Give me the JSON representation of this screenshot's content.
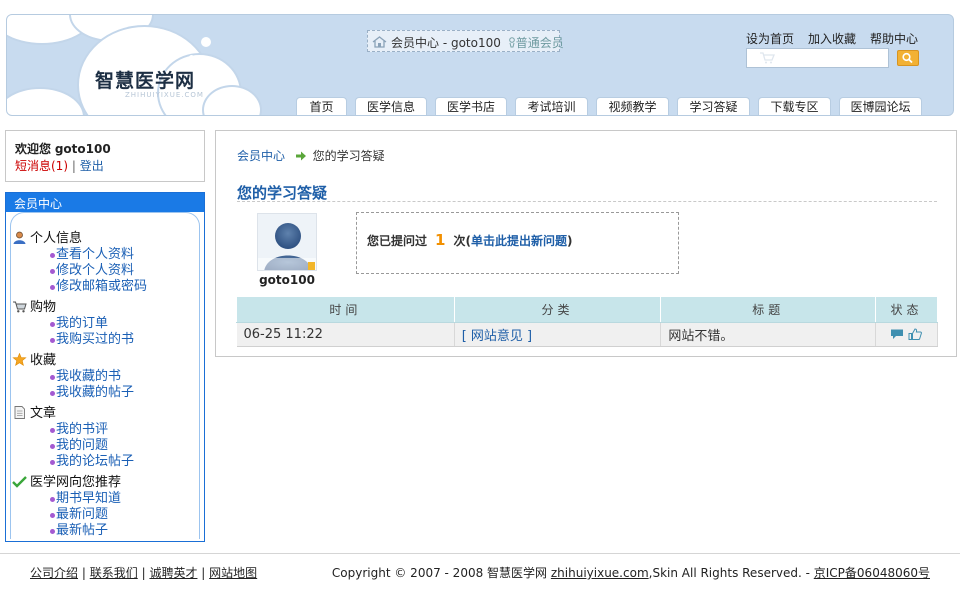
{
  "header": {
    "logo": "智慧医学网",
    "logo_sub": "ZHIHUIYIXUE.COM",
    "user_badge": {
      "text": "会员中心 - goto100",
      "level": "普通会员"
    },
    "top_links": [
      "设为首页",
      "加入收藏",
      "帮助中心"
    ],
    "search": {
      "value": "",
      "placeholder": ""
    },
    "nav_tabs": [
      "首页",
      "医学信息",
      "医学书店",
      "考试培训",
      "视频教学",
      "学习答疑",
      "下载专区",
      "医博园论坛"
    ]
  },
  "sidebar": {
    "welcome_label": "欢迎您",
    "username": "goto100",
    "messages_link": "短消息(1)",
    "separator": "|",
    "logout_link": "登出",
    "member_title": "会员中心",
    "categories": [
      {
        "label": "个人信息",
        "icon": "person-icon",
        "items": [
          "查看个人资料",
          "修改个人资料",
          "修改邮箱或密码"
        ]
      },
      {
        "label": "购物",
        "icon": "cart-icon",
        "items": [
          "我的订单",
          "我购买过的书"
        ]
      },
      {
        "label": "收藏",
        "icon": "star-icon",
        "items": [
          "我收藏的书",
          "我收藏的帖子"
        ]
      },
      {
        "label": "文章",
        "icon": "document-icon",
        "items": [
          "我的书评",
          "我的问题",
          "我的论坛帖子"
        ]
      },
      {
        "label": "医学网向您推荐",
        "icon": "checkmark-icon",
        "items": [
          "期书早知道",
          "最新问题",
          "最新帖子"
        ]
      }
    ]
  },
  "main": {
    "breadcrumb_home": "会员中心",
    "breadcrumb_current": "您的学习答疑",
    "page_title": "您的学习答疑",
    "avatar_name": "goto100",
    "ask_prefix": "您已提问过",
    "ask_count": "1",
    "ask_suffix": "次(",
    "ask_link": "单击此提出新问题",
    "ask_close": ")",
    "table": {
      "headers": [
        "时间",
        "分类",
        "标题",
        "状态"
      ],
      "rows": [
        {
          "time": "06-25 11:22",
          "category": "[ 网站意见 ]",
          "title": "网站不错。"
        }
      ]
    }
  },
  "footer": {
    "links": [
      "公司介绍",
      "联系我们",
      "诚聘英才",
      "网站地图"
    ],
    "separator": "|",
    "copyright_prefix": "Copyright © 2007 - 2008 智慧医学网",
    "copyright_domain": "zhihuiyixue.com",
    "copyright_mid": ",Skin All Rights Reserved. - ",
    "icp": "京ICP备06048060号"
  }
}
